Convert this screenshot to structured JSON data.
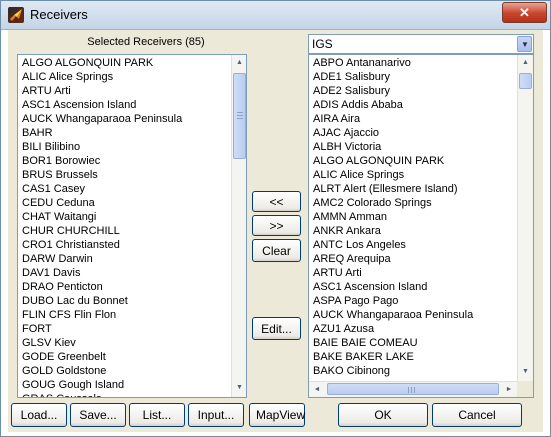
{
  "window": {
    "title": "Receivers",
    "close_label": "✕"
  },
  "selected_panel": {
    "label": "Selected Receivers (85)",
    "items": [
      "ALGO ALGONQUIN PARK",
      "ALIC Alice Springs",
      "ARTU Arti",
      "ASC1 Ascension Island",
      "AUCK Whangaparaoa Peninsula",
      "BAHR",
      "BILI Bilibino",
      "BOR1 Borowiec",
      "BRUS Brussels",
      "CAS1 Casey",
      "CEDU Ceduna",
      "CHAT Waitangi",
      "CHUR CHURCHILL",
      "CRO1 Christiansted",
      "DARW Darwin",
      "DAV1 Davis",
      "DRAO Penticton",
      "DUBO Lac du Bonnet",
      "FLIN CFS Flin Flon",
      "FORT",
      "GLSV Kiev",
      "GODE Greenbelt",
      "GOLD Goldstone",
      "GOUG Gough Island",
      "GRAS Caussols"
    ]
  },
  "network_select": {
    "value": "IGS"
  },
  "available_panel": {
    "items": [
      "ABPO Antananarivo",
      "ADE1 Salisbury",
      "ADE2 Salisbury",
      "ADIS Addis Ababa",
      "AIRA Aira",
      "AJAC Ajaccio",
      "ALBH Victoria",
      "ALGO ALGONQUIN PARK",
      "ALIC Alice Springs",
      "ALRT Alert (Ellesmere Island)",
      "AMC2 Colorado Springs",
      "AMMN Amman",
      "ANKR Ankara",
      "ANTC Los Angeles",
      "AREQ Arequipa",
      "ARTU Arti",
      "ASC1 Ascension Island",
      "ASPA Pago Pago",
      "AUCK Whangaparaoa Peninsula",
      "AZU1 Azusa",
      "BAIE BAIE COMEAU",
      "BAKE BAKER LAKE",
      "BAKO Cibinong"
    ]
  },
  "transfer_buttons": {
    "add": "<<",
    "remove": ">>",
    "clear": "Clear",
    "edit": "Edit..."
  },
  "bottom_buttons": {
    "load": "Load...",
    "save": "Save...",
    "list": "List...",
    "input": "Input...",
    "mapview": "MapView",
    "ok": "OK",
    "cancel": "Cancel"
  },
  "icons": {
    "app": "matlab-logo-icon",
    "scroll_up": "▲",
    "scroll_down": "▼",
    "scroll_left": "◄",
    "scroll_right": "►",
    "combo_arrow": "▼"
  }
}
